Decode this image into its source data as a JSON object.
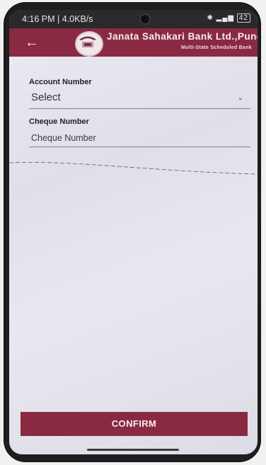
{
  "status_bar": {
    "time_speed": "4:16 PM | 4.0KB/s",
    "battery": "42"
  },
  "header": {
    "bank_name": "Janata Sahakari Bank Ltd.,Pune",
    "subtitle": "Multi-State Scheduled Bank",
    "bar_color": "#8a2a42"
  },
  "form": {
    "account_label": "Account Number",
    "account_value": "Select",
    "cheque_label": "Cheque Number",
    "cheque_placeholder": "Cheque Number"
  },
  "actions": {
    "confirm_label": "CONFIRM"
  }
}
